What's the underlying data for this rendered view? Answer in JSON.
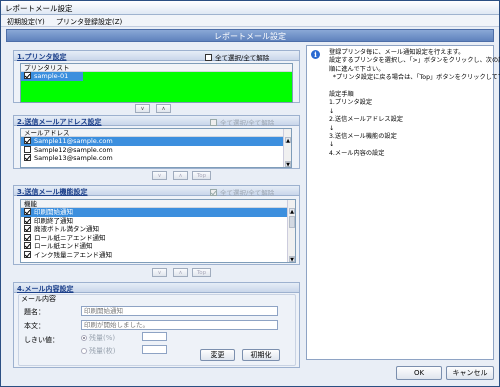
{
  "window": {
    "title": "レポートメール設定"
  },
  "menu": {
    "items": [
      "初期設定(Y)",
      "プリンタ登録設定(Z)"
    ]
  },
  "header": {
    "title": "レポートメール設定"
  },
  "printer": {
    "title": "1.プリンタ設定",
    "select_all_label": "全て選択/全て解除",
    "select_all_checked": false,
    "list_header": "プリンタリスト",
    "items": [
      {
        "label": "sample-01",
        "checked": true
      }
    ],
    "highlight_color": "#00ff00"
  },
  "email": {
    "title": "2.送信メールアドレス設定",
    "select_all_label": "全て選択/全て解除",
    "list_header": "メールアドレス",
    "items": [
      {
        "label": "Sample11@sample.com",
        "checked": true,
        "selected": true
      },
      {
        "label": "Sample12@sample.com",
        "checked": false
      },
      {
        "label": "Sample13@sample.com",
        "checked": true
      }
    ],
    "top_label": "Top"
  },
  "function": {
    "title": "3.送信メール機能設定",
    "select_all_label": "全て選択/全て解除",
    "list_header": "機能",
    "items": [
      {
        "label": "印刷開始通知",
        "checked": true,
        "selected": true
      },
      {
        "label": "印刷終了通知",
        "checked": true
      },
      {
        "label": "廃液ボトル満タン通知",
        "checked": true
      },
      {
        "label": "ロール紙ニアエンド通知",
        "checked": true
      },
      {
        "label": "ロール紙エンド通知",
        "checked": true
      },
      {
        "label": "インク残量ニアエンド通知",
        "checked": true
      }
    ],
    "top_label": "Top"
  },
  "content": {
    "title": "4.メール内容設定",
    "group_label": "メール内容",
    "subject_label": "題名：",
    "subject_value": "印刷開始通知",
    "body_label": "本文：",
    "body_value": "印刷が開始しました。",
    "threshold_label": "しきい値：",
    "radio1_label": "残量(%)",
    "radio2_label": "残量(枚)",
    "change_button": "変更",
    "init_button": "初期化"
  },
  "info": {
    "text": "登録プリンタ毎に、メール通知設定を行えます。\n設定するプリンタを選択し、「>」ボタンをクリックし、次の設定手\n順に進んで下さい。\n  *プリンタ設定に戻る場合は、「Top」ボタンをクリックして下さい。\n\n設定手順\n1.プリンタ設定\n↓\n2.送信メールアドレス設定\n↓\n3.送信メール機能の設定\n↓\n4.メール内容の設定"
  },
  "footer": {
    "ok_label": "OK",
    "cancel_label": "キャンセル"
  }
}
